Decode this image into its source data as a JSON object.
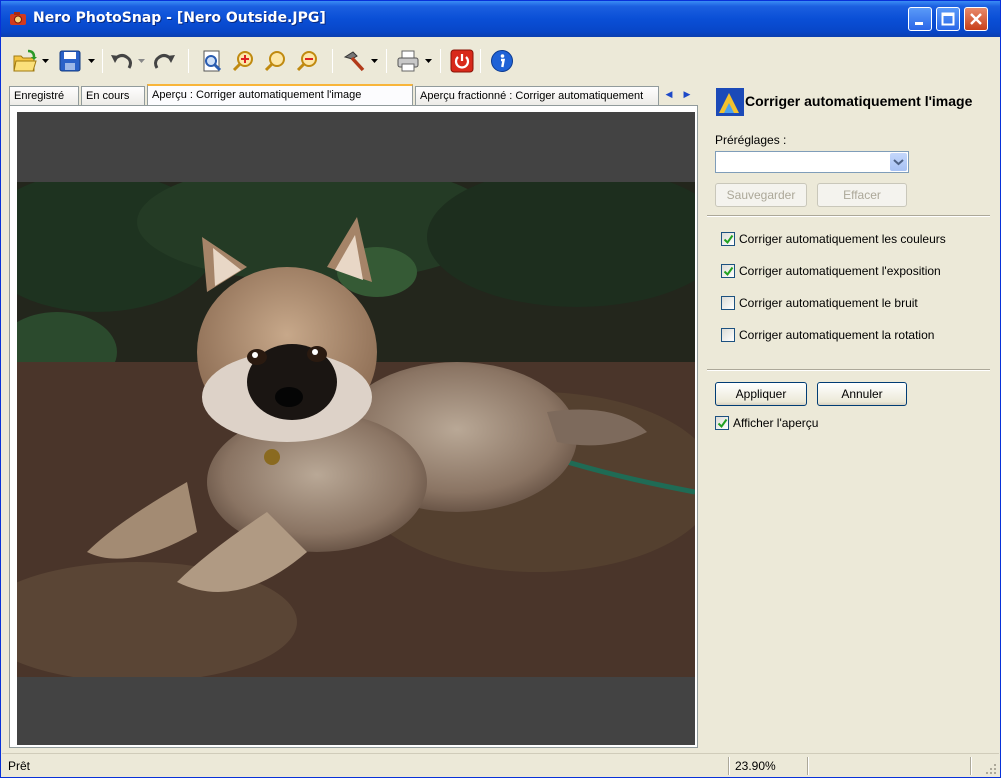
{
  "window": {
    "title": "Nero PhotoSnap - [Nero Outside.JPG]"
  },
  "toolbar": {
    "items": [
      "open-icon",
      "save-icon",
      "undo-icon",
      "redo-icon",
      "page-view-icon",
      "zoom-in-icon",
      "zoom-icon",
      "zoom-out-icon",
      "tools-icon",
      "print-icon",
      "power-icon",
      "info-icon"
    ]
  },
  "tabs": [
    {
      "label": "Enregistré"
    },
    {
      "label": "En cours"
    },
    {
      "label": "Aperçu : Corriger automatiquement l'image"
    },
    {
      "label": "Aperçu fractionné : Corriger automatiquement"
    }
  ],
  "panel": {
    "title": "Corriger automatiquement l'image",
    "presets_label": "Préréglages :",
    "presets_value": "",
    "save_label": "Sauvegarder",
    "clear_label": "Effacer",
    "options": [
      {
        "label": "Corriger automatiquement les couleurs",
        "checked": true
      },
      {
        "label": "Corriger automatiquement l'exposition",
        "checked": true
      },
      {
        "label": "Corriger automatiquement le bruit",
        "checked": false
      },
      {
        "label": "Corriger automatiquement la rotation",
        "checked": false
      }
    ],
    "apply_label": "Appliquer",
    "cancel_label": "Annuler",
    "preview_label": "Afficher l'aperçu",
    "preview_checked": true
  },
  "status": {
    "text": "Prêt",
    "zoom": "23.90%"
  },
  "colors": {
    "titlebar": "#0a4fd6",
    "tab_highlight": "#f8b53a",
    "canvas": "#434343",
    "check": "#21a121"
  }
}
